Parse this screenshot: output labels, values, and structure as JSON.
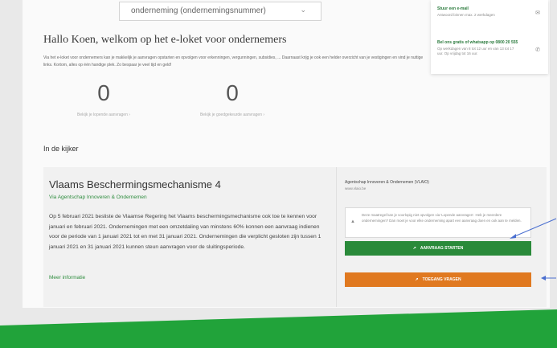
{
  "company_select": {
    "value": "onderneming (ondernemingsnummer)"
  },
  "contact": {
    "email": {
      "title": "Stuur een e-mail",
      "detail": "Antwoord binnen max. 2 werkdagen"
    },
    "whatsapp": {
      "title": "Bel ons gratis of whatsapp op 0800 20 555",
      "detail_1": "Op werkdagen van 8 tot 12 uur en van 13 tot 17",
      "detail_2": "uur. Op vrijdag tot 16 uur."
    }
  },
  "welcome": {
    "title": "Hallo Koen, welkom op het e-loket voor ondernemers",
    "intro": "Via het e-loket voor ondernemers kan je makkelijk je aanvragen opstarten en opvolgen voor erkenningen, vergunningen, subsidies, ... Daarnaast krijg je ook een helder overzicht van je vestigingen en vind je nuttige links. Kortom, alles op één handige plek. Zo bespaar je veel tijd en geld!"
  },
  "counters": [
    {
      "value": "0",
      "label": "Bekijk je lopende aanvragen ›"
    },
    {
      "value": "0",
      "label": "Bekijk je goedgekeurde aanvragen ›"
    }
  ],
  "section_title": "In de kijker",
  "featured": {
    "title": "Vlaams Beschermingsmechanisme 4",
    "via": "Via Agentschap Innoveren & Ondernemen",
    "body": "Op 5 februari 2021 besliste de Vlaamse Regering het Vlaams beschermingsmechanisme ook toe te kennen voor januari en februari 2021. Ondernemingen met een omzetdaling van minstens 60% konnen een aanvraag indienen voor de periode van 1 januari 2021 tot en met 31 januari 2021. Ondernemingen die verplicht gesloten zijn tussen 1 januari 2021 en 31 januari 2021 kunnen steun aanvragen voor de sluitingsperiode.",
    "more_link": "Meer informatie",
    "agency": "Agentschap Innoveren & Ondernemen (VLAIO)",
    "agency_url": "www.vlaio.be",
    "notice": "Deze maatregel kan je voorlopig niet opvolgen via 'Lopende aanvragen'. Heb je meerdere ondernemingen? Dan moet je voor elke onderneming apart een aanvraag doen en ook aan te melden.",
    "start_button": "AANVRAAG STARTEN",
    "access_button": "TOEGANG VRAGEN"
  },
  "colors": {
    "green": "#2a8a3a",
    "orange": "#e07920",
    "banner_green": "#21a33a"
  }
}
